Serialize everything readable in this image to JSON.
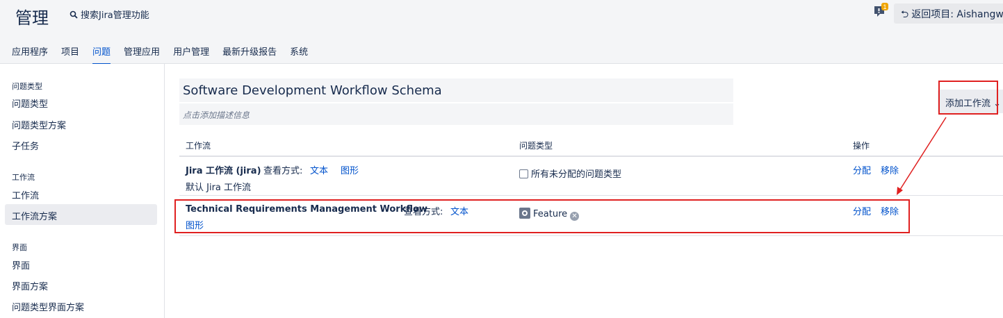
{
  "header": {
    "title": "管理",
    "search_label": "搜索Jira管理功能",
    "back_label": "返回项目: Aishangwei",
    "feedback_badge": "1"
  },
  "nav_tabs": [
    "应用程序",
    "项目",
    "问题",
    "管理应用",
    "用户管理",
    "最新升级报告",
    "系统"
  ],
  "active_tab": "问题",
  "sidebar": {
    "sections": [
      {
        "heading": "问题类型",
        "items": [
          "问题类型",
          "问题类型方案",
          "子任务"
        ]
      },
      {
        "heading": "工作流",
        "items": [
          "工作流",
          "工作流方案"
        ]
      },
      {
        "heading": "界面",
        "items": [
          "界面",
          "界面方案",
          "问题类型界面方案"
        ]
      }
    ],
    "active_item": "工作流方案"
  },
  "schema": {
    "title": "Software Development Workflow Schema",
    "desc_placeholder": "点击添加描述信息",
    "add_button": "添加工作流"
  },
  "table": {
    "headers": [
      "工作流",
      "问题类型",
      "操作"
    ],
    "view_label": "查看方式:",
    "rows": [
      {
        "workflow": "Jira 工作流 (jira)",
        "view_text": "文本",
        "view_diagram": "图形",
        "subtitle": "默认 Jira 工作流",
        "issue_type": "所有未分配的问题类型",
        "assign": "分配",
        "remove": "移除"
      },
      {
        "workflow": "Technical Requirements Management Workflow",
        "view_text": "文本",
        "view_diagram": "图形",
        "issue_type": "Feature",
        "assign": "分配",
        "remove": "移除"
      }
    ]
  },
  "colors": {
    "accent": "#0052cc",
    "highlight": "#e02020",
    "badge": "#f0a500"
  }
}
